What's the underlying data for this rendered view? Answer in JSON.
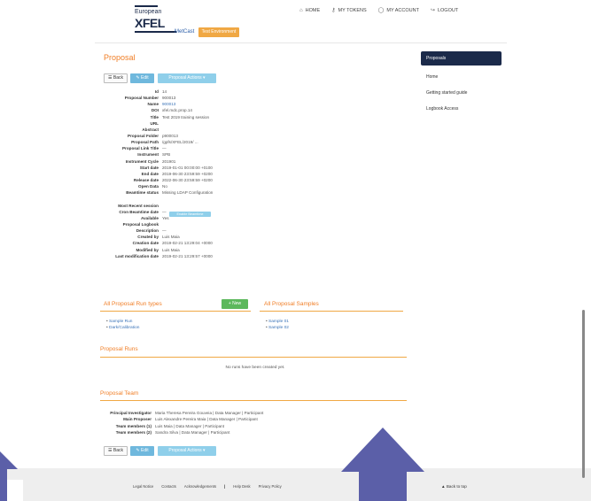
{
  "header": {
    "logo_name": "European",
    "logo_xfel": "XFEL",
    "logo_sub": "MetCast",
    "env_badge": "Test Environment",
    "nav": [
      {
        "label": "HOME",
        "icon": "home-icon"
      },
      {
        "label": "MY TOKENS",
        "icon": "key-icon"
      },
      {
        "label": "MY ACCOUNT",
        "icon": "user-icon"
      },
      {
        "label": "LOGOUT",
        "icon": "logout-icon"
      }
    ]
  },
  "page": {
    "title": "Proposal",
    "back_label": "Back",
    "edit_label": "Edit",
    "actions_label": "Proposal Actions ▾"
  },
  "details": [
    {
      "label": "Id",
      "value": "14"
    },
    {
      "label": "Proposal Number",
      "value": "900013",
      "link": false
    },
    {
      "label": "Name",
      "value": "900013",
      "link": true
    },
    {
      "label": "DOI",
      "value": "xfel.mdc.prop.14"
    },
    {
      "label": "Title",
      "value": "Test 2019 training session"
    },
    {
      "label": "URL",
      "value": ""
    },
    {
      "label": "Abstract",
      "value": ""
    },
    {
      "label": "Proposal Folder",
      "value": "p900013"
    },
    {
      "label": "Proposal Path",
      "value": "/gpfs/XFEL/2019/ ..."
    },
    {
      "label": "Proposal Link Title",
      "value": "—"
    },
    {
      "label": "Instrument",
      "value": "SPB"
    },
    {
      "label": "Instrument Cycle",
      "value": "201901"
    },
    {
      "label": "Start date",
      "value": "2019-01-01 00:00:00 +0100"
    },
    {
      "label": "End date",
      "value": "2019-06-30 23:59:59 +0200"
    },
    {
      "label": "Release date",
      "value": "2022-06-30 23:59:59 +0200"
    },
    {
      "label": "Open Data",
      "value": "No"
    },
    {
      "label": "Beamtime status",
      "value": "Missing LDAP Configuration"
    },
    {
      "label": "",
      "value": ""
    },
    {
      "label": "Most Recent session",
      "value": ""
    },
    {
      "label": "Cron Beamtime date",
      "value": "—"
    },
    {
      "label": "Available",
      "value": "Yes"
    },
    {
      "label": "Proposal Logbook",
      "value": ""
    },
    {
      "label": "Description",
      "value": "—"
    },
    {
      "label": "Created by",
      "value": "Luis Maia"
    },
    {
      "label": "Creation date",
      "value": "2019-02-21 13:29:04 +0000"
    },
    {
      "label": "Modified by",
      "value": "Luis Maia"
    },
    {
      "label": "Last modification date",
      "value": "2019-02-21 13:29:57 +0000"
    }
  ],
  "beamtime_button": "Enable Beamtime",
  "sidebar": {
    "items": [
      {
        "label": "Proposals",
        "active": true
      },
      {
        "label": "Home",
        "active": false
      },
      {
        "label": "Getting started guide",
        "active": false
      },
      {
        "label": "Logbook Access",
        "active": false
      }
    ]
  },
  "runtypes": {
    "title": "All Proposal Run types",
    "new_label": "+ New",
    "items": [
      "Sample Run",
      "Dark/Calibration"
    ]
  },
  "samples": {
    "title": "All Proposal Samples",
    "items": [
      "Sample 01",
      "Sample 02"
    ]
  },
  "runs": {
    "title": "Proposal Runs",
    "empty": "No runs have been created yet."
  },
  "team": {
    "title": "Proposal Team",
    "rows": [
      {
        "label": "Principal Investigator",
        "value": "Maria Theresa Pereira Gouveia | Data Manager | Participant"
      },
      {
        "label": "Main Proposer",
        "value": "Luis Alexandre Pereira Maia | Data Manager | Participant"
      },
      {
        "label": "Team members (1)",
        "value": "Luis Maia | Data Manager | Participant"
      },
      {
        "label": "Team members (2)",
        "value": "Sandra Silva | Data Manager | Participant"
      }
    ]
  },
  "footer": {
    "links": [
      "Legal Notice",
      "Contacts",
      "Acknowledgements",
      "Help Desk",
      "Privacy Policy"
    ],
    "right": "Back to top"
  },
  "colors": {
    "accent": "#f07e26",
    "primary_dark": "#1b2a4a",
    "button_blue": "#6fb8dd",
    "button_light_blue": "#8fcfea",
    "success": "#5cb85c",
    "overlay_arrow": "#5b5fa8"
  }
}
